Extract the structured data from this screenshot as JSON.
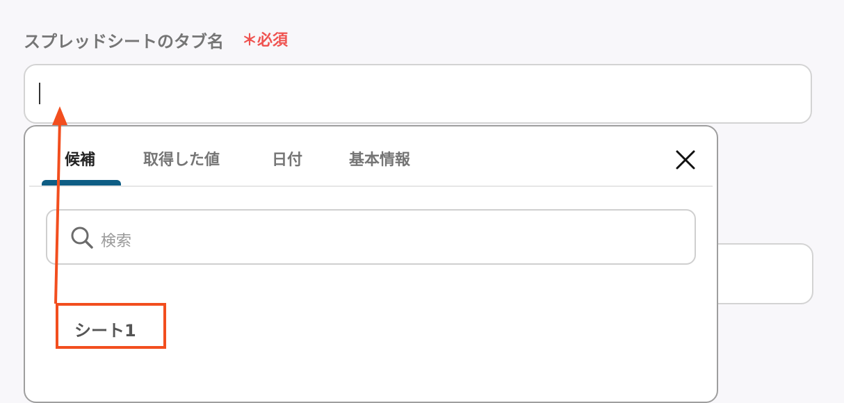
{
  "field": {
    "label": "スプレッドシートのタブ名",
    "required_mark": "＊",
    "required_text": "必須",
    "value": ""
  },
  "panel": {
    "tabs": [
      {
        "label": "候補",
        "active": true
      },
      {
        "label": "取得した値",
        "active": false
      },
      {
        "label": "日付",
        "active": false
      },
      {
        "label": "基本情報",
        "active": false
      }
    ],
    "close_icon": "close-icon",
    "search": {
      "icon": "search-icon",
      "placeholder": "検索"
    },
    "options": [
      {
        "label": "シート1",
        "highlighted": true
      }
    ]
  },
  "colors": {
    "required": "#ef5350",
    "tab_active_indicator": "#0e5d84",
    "annotation": "#f24e1e"
  }
}
